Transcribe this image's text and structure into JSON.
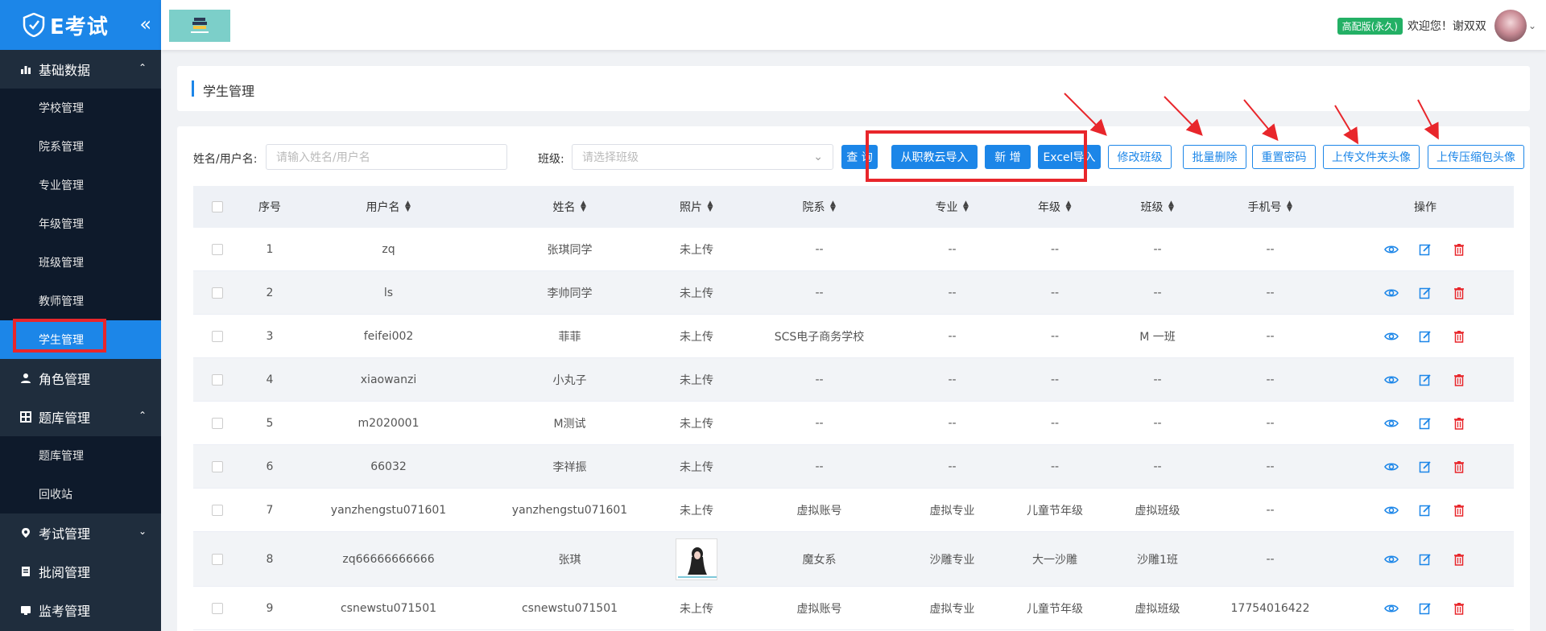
{
  "brand": {
    "logo_text": "E考试",
    "collapse_icon": "double-chevron-left-icon"
  },
  "sidebar": {
    "groups": [
      {
        "label": "基础数据",
        "icon": "bar-chart-icon",
        "expanded": true,
        "items": [
          "学校管理",
          "院系管理",
          "专业管理",
          "年级管理",
          "班级管理",
          "教师管理",
          "学生管理"
        ],
        "active": "学生管理"
      },
      {
        "label": "角色管理",
        "icon": "user-icon"
      },
      {
        "label": "题库管理",
        "icon": "grid-icon",
        "expanded": true,
        "items": [
          "题库管理",
          "回收站"
        ]
      },
      {
        "label": "考试管理",
        "icon": "map-pin-icon",
        "expanded": false
      },
      {
        "label": "批阅管理",
        "icon": "document-icon"
      },
      {
        "label": "监考管理",
        "icon": "monitor-icon"
      }
    ]
  },
  "header": {
    "badge": "高配版(永久)",
    "welcome": "欢迎您！谢双双"
  },
  "page": {
    "title": "学生管理"
  },
  "filters": {
    "name_label": "姓名/用户名:",
    "name_placeholder": "请输入姓名/用户名",
    "class_label": "班级:",
    "class_placeholder": "请选择班级"
  },
  "toolbar": {
    "query": "查 询",
    "import_cloud": "从职教云导入",
    "add": "新 增",
    "excel_import": "Excel导入",
    "change_class": "修改班级",
    "batch_delete": "批量删除",
    "reset_password": "重置密码",
    "upload_folder_avatar": "上传文件夹头像",
    "upload_zip_avatar": "上传压缩包头像"
  },
  "table": {
    "columns": [
      "序号",
      "用户名",
      "姓名",
      "照片",
      "院系",
      "专业",
      "年级",
      "班级",
      "手机号",
      "操作"
    ],
    "rows": [
      {
        "no": "1",
        "username": "zq",
        "name": "张琪同学",
        "photo": "未上传",
        "dept": "--",
        "major": "--",
        "grade": "--",
        "class": "--",
        "phone": "--"
      },
      {
        "no": "2",
        "username": "ls",
        "name": "李帅同学",
        "photo": "未上传",
        "dept": "--",
        "major": "--",
        "grade": "--",
        "class": "--",
        "phone": "--"
      },
      {
        "no": "3",
        "username": "feifei002",
        "name": "菲菲",
        "photo": "未上传",
        "dept": "SCS电子商务学校",
        "major": "--",
        "grade": "--",
        "class": "M 一班",
        "phone": "--"
      },
      {
        "no": "4",
        "username": "xiaowanzi",
        "name": "小丸子",
        "photo": "未上传",
        "dept": "--",
        "major": "--",
        "grade": "--",
        "class": "--",
        "phone": "--"
      },
      {
        "no": "5",
        "username": "m2020001",
        "name": "M测试",
        "photo": "未上传",
        "dept": "--",
        "major": "--",
        "grade": "--",
        "class": "--",
        "phone": "--"
      },
      {
        "no": "6",
        "username": "66032",
        "name": "李祥振",
        "photo": "未上传",
        "dept": "--",
        "major": "--",
        "grade": "--",
        "class": "--",
        "phone": "--"
      },
      {
        "no": "7",
        "username": "yanzhengstu071601",
        "name": "yanzhengstu071601",
        "photo": "未上传",
        "dept": "虚拟账号",
        "major": "虚拟专业",
        "grade": "儿童节年级",
        "class": "虚拟班级",
        "phone": "--"
      },
      {
        "no": "8",
        "username": "zq66666666666",
        "name": "张琪",
        "photo": "",
        "dept": "魔女系",
        "major": "沙雕专业",
        "grade": "大一沙雕",
        "class": "沙雕1班",
        "phone": "--"
      },
      {
        "no": "9",
        "username": "csnewstu071501",
        "name": "csnewstu071501",
        "photo": "未上传",
        "dept": "虚拟账号",
        "major": "虚拟专业",
        "grade": "儿童节年级",
        "class": "虚拟班级",
        "phone": "17754016422"
      }
    ]
  }
}
